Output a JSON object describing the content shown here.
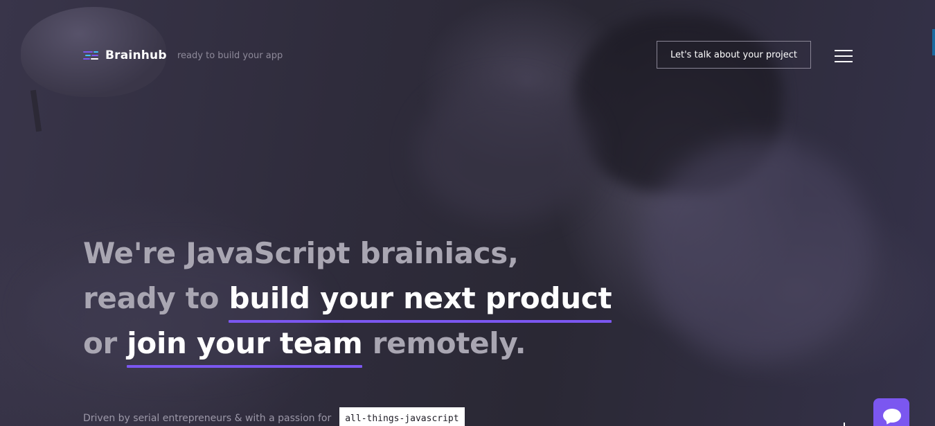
{
  "header": {
    "brand_name": "Brainhub",
    "tagline": "ready to build your app",
    "cta_label": "Let's talk about your project",
    "menu_icon": "hamburger-menu-icon",
    "logo_icon": "brainhub-logo-icon"
  },
  "hero": {
    "line1": "We're JavaScript brainiacs,",
    "line2_prefix": "ready to ",
    "line2_highlight": "build your next product",
    "line3_prefix": "or ",
    "line3_highlight": "join your team",
    "line3_suffix": " remotely.",
    "subline": "Driven by serial entrepreneurs & with a passion for",
    "badge": "all-things-javascript"
  },
  "chat": {
    "icon": "chat-bubble-icon"
  },
  "colors": {
    "accent": "#7b57f0",
    "background": "#2a2733",
    "heading_muted": "#a9a6b2",
    "heading_strong": "#ffffff",
    "edge_tab": "#1a6aa0"
  }
}
